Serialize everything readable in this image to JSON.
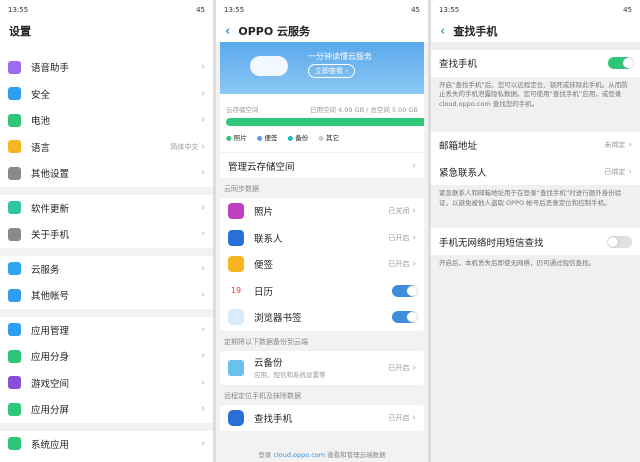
{
  "status": {
    "time": "13:55",
    "battery": "45"
  },
  "settings": {
    "title": "设置",
    "groups": [
      [
        {
          "label": "语音助手",
          "icon": "microphone-icon",
          "color": "#9b6cf0"
        },
        {
          "label": "安全",
          "icon": "shield-icon",
          "color": "#2f9ef0"
        },
        {
          "label": "电池",
          "icon": "battery-icon",
          "color": "#2ec77a"
        },
        {
          "label": "语言",
          "icon": "language-icon",
          "color": "#f5b622",
          "value": "简体中文"
        },
        {
          "label": "其他设置",
          "icon": "gear-icon",
          "color": "#8a8a8a"
        }
      ],
      [
        {
          "label": "软件更新",
          "icon": "update-icon",
          "color": "#2ec7a0"
        },
        {
          "label": "关于手机",
          "icon": "info-icon",
          "color": "#8a8a8a"
        }
      ],
      [
        {
          "label": "云服务",
          "icon": "cloud-icon",
          "color": "#2fa6f0"
        },
        {
          "label": "其他帐号",
          "icon": "account-icon",
          "color": "#2f9ef0"
        }
      ],
      [
        {
          "label": "应用管理",
          "icon": "apps-icon",
          "color": "#2f9ef0"
        },
        {
          "label": "应用分身",
          "icon": "clone-icon",
          "color": "#2ec77a"
        },
        {
          "label": "游戏空间",
          "icon": "game-icon",
          "color": "#8a4fd8"
        },
        {
          "label": "应用分屏",
          "icon": "split-screen-icon",
          "color": "#2ec77a"
        }
      ],
      [
        {
          "label": "系统应用",
          "icon": "system-apps-icon",
          "color": "#2ec77a"
        }
      ]
    ]
  },
  "cloud": {
    "title": "OPPO 云服务",
    "banner_text": "一分钟读懂云服务",
    "banner_button": "立即查看 ›",
    "storage_label": "云存储空间",
    "storage_usage": "已用空间 4.99 GB / 总空间 5.00 GB",
    "storage_used_fraction": 0.998,
    "legend": [
      {
        "label": "照片",
        "color": "#2ec77a"
      },
      {
        "label": "便签",
        "color": "#5b9bf0"
      },
      {
        "label": "备份",
        "color": "#20b8c8"
      },
      {
        "label": "其它",
        "color": "#cccccc"
      }
    ],
    "manage": "管理云存储空间",
    "sync_label": "云同步数据",
    "sync": [
      {
        "label": "照片",
        "value": "已关闭",
        "icon": "photos-icon",
        "color": "#c03fbf"
      },
      {
        "label": "联系人",
        "value": "已开启",
        "icon": "contacts-icon",
        "color": "#2a6fd8"
      },
      {
        "label": "便签",
        "value": "已开启",
        "icon": "notes-icon",
        "color": "#f5b622"
      },
      {
        "label": "日历",
        "toggle": true,
        "icon": "calendar-icon",
        "color": "#ffffff",
        "calendar_day": "19"
      },
      {
        "label": "浏览器书签",
        "toggle": true,
        "icon": "browser-icon",
        "color": "#d8ecfb"
      }
    ],
    "backup_label": "定期将以下数据备份到云端",
    "backup": {
      "label": "云备份",
      "sub": "应用、短信和系统设置等",
      "value": "已开启"
    },
    "find_label": "远程定位手机及抹除数据",
    "find": {
      "label": "查找手机",
      "value": "已开启"
    },
    "footer_pre": "登录 ",
    "footer_link": "cloud.oppo.com",
    "footer_post": " 查看和管理云端数据"
  },
  "find": {
    "title": "查找手机",
    "toggle_label": "查找手机",
    "toggle_on": true,
    "desc1": "开启“查找手机”后，您可以远程定位、锁死或抹除此手机。从而防止丢失的手机泄露隐私数据。您可使用“查找手机”应用，或登录 cloud.oppo.com 查找您的手机。",
    "email": {
      "label": "邮箱地址",
      "value": "未绑定"
    },
    "contact": {
      "label": "紧急联系人",
      "value": "已绑定"
    },
    "desc2": "紧急联系人和邮箱地址用于在登录“查找手机”时进行额外身份验证，以避免被他人盗取 OPPO 帐号后恶意定位和控制手机。",
    "sms_label": "手机无网络时用短信查找",
    "sms_on": false,
    "desc3": "开启后，本机丢失后即使无网络，仍可通过短信查找。"
  },
  "colors": {
    "accent": "#3a8fd8",
    "green": "#2ec77a"
  }
}
